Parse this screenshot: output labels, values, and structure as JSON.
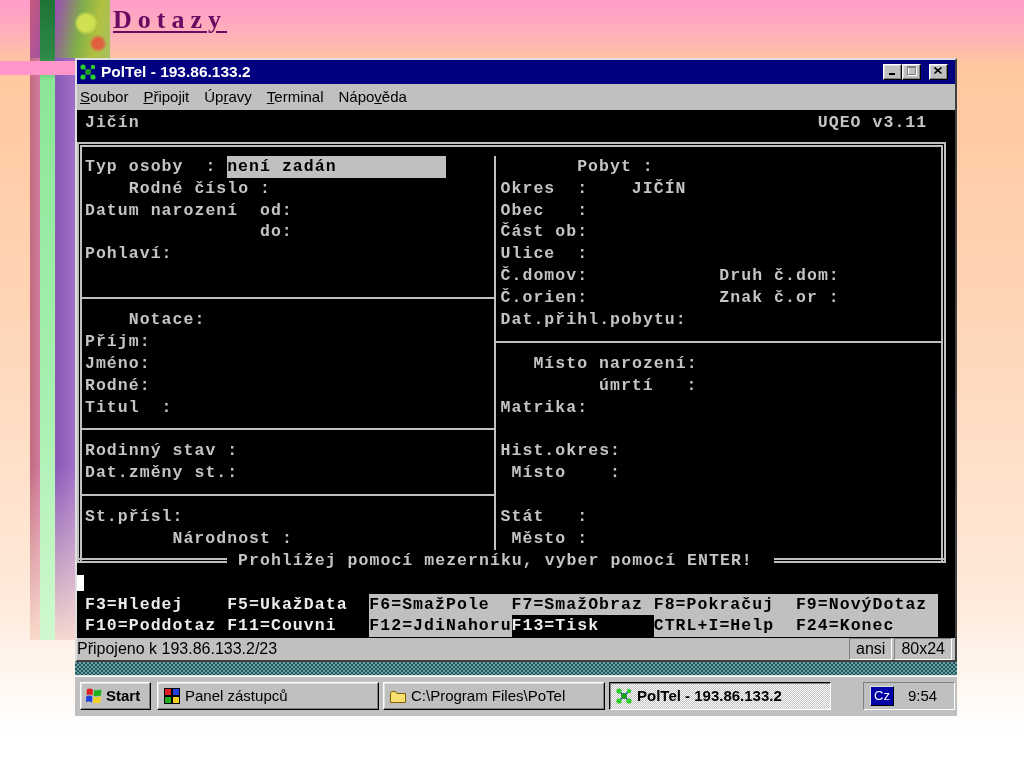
{
  "slide": {
    "title": "Dotazy"
  },
  "window": {
    "title": "PolTel - 193.86.133.2",
    "controls": [
      {
        "kind": "minimize",
        "disabled": false
      },
      {
        "kind": "maximize",
        "disabled": true
      },
      {
        "kind": "close",
        "disabled": false
      }
    ]
  },
  "menu": [
    {
      "key": "S",
      "post": "oubor"
    },
    {
      "key": "P",
      "post": "řipojit"
    },
    {
      "pre": "Úp",
      "key": "r",
      "post": "avy"
    },
    {
      "key": "T",
      "post": "erminal"
    },
    {
      "pre": "Nápo",
      "key": "v",
      "post": "ěda"
    }
  ],
  "terminal": {
    "header": {
      "location": "Jičín",
      "version": "UQEO v3.11"
    },
    "left_panel": [
      {
        "label": "Typ osoby  :",
        "value": "není zadán",
        "focused": true
      },
      {
        "label": "Rodné číslo :"
      },
      {
        "label": "Datum narození"
      },
      {
        "label": "od:"
      },
      {
        "label": "do:"
      },
      {
        "label": "Pohlaví:"
      },
      {
        "label": "Notace:"
      },
      {
        "label": "Příjm:"
      },
      {
        "label": "Jméno:"
      },
      {
        "label": "Rodné:"
      },
      {
        "label": "Titul  :"
      },
      {
        "label": "Rodinný stav :"
      },
      {
        "label": "Dat.změny st.:"
      },
      {
        "label": "St.přísl:"
      },
      {
        "label": "Národnost :"
      }
    ],
    "right_panel": [
      {
        "label": "Pobyt :"
      },
      {
        "label": "Okres  :",
        "value": "JIČÍN",
        "focused": false
      },
      {
        "label": "Obec   :"
      },
      {
        "label": "Část ob:"
      },
      {
        "label": "Ulice  :"
      },
      {
        "label": "Č.domov:"
      },
      {
        "label": "Druh č.dom:"
      },
      {
        "label": "Č.orien:"
      },
      {
        "label": "Znak č.or :"
      },
      {
        "label": "Dat.přihl.pobytu:"
      },
      {
        "label": "Místo narození:"
      },
      {
        "label": "úmrtí   :"
      },
      {
        "label": "Matrika:"
      },
      {
        "label": "Hist.okres:"
      },
      {
        "label": "Místo    :"
      },
      {
        "label": "Stát   :"
      },
      {
        "label": "Město :"
      }
    ],
    "message": "Prohlížej pomocí mezerníku, vyber pomocí ENTER!",
    "function_keys": [
      {
        "label": "F3=Hledej",
        "highlighted": false
      },
      {
        "label": "F5=UkažData",
        "highlighted": false
      },
      {
        "label": "F6=SmažPole",
        "highlighted": true
      },
      {
        "label": "F7=SmažObraz",
        "highlighted": true
      },
      {
        "label": "F8=Pokračuj",
        "highlighted": true
      },
      {
        "label": "F9=NovýDotaz",
        "highlighted": true
      },
      {
        "label": "F10=Poddotaz",
        "highlighted": false
      },
      {
        "label": "F11=Couvni",
        "highlighted": false
      },
      {
        "label": "F12=JdiNahoru",
        "highlighted": true
      },
      {
        "label": "F13=Tisk",
        "highlighted": false
      },
      {
        "label": "CTRL+I=Help",
        "highlighted": true
      },
      {
        "label": "F24=Konec",
        "highlighted": true
      }
    ]
  },
  "status_bar": {
    "connection": "Připojeno k 193.86.133.2/23",
    "panels": [
      "ansi",
      "80x24"
    ]
  },
  "taskbar": {
    "start": "Start",
    "tasks": [
      {
        "kind": "group",
        "label": "Panel zástupců",
        "selected": false
      },
      {
        "kind": "folder",
        "label": "C:\\Program Files\\PoTel",
        "selected": false
      },
      {
        "kind": "app",
        "label": "PolTel - 193.86.133.2",
        "selected": true
      }
    ],
    "tray": {
      "language": "Cz",
      "clock": "9:54"
    }
  }
}
